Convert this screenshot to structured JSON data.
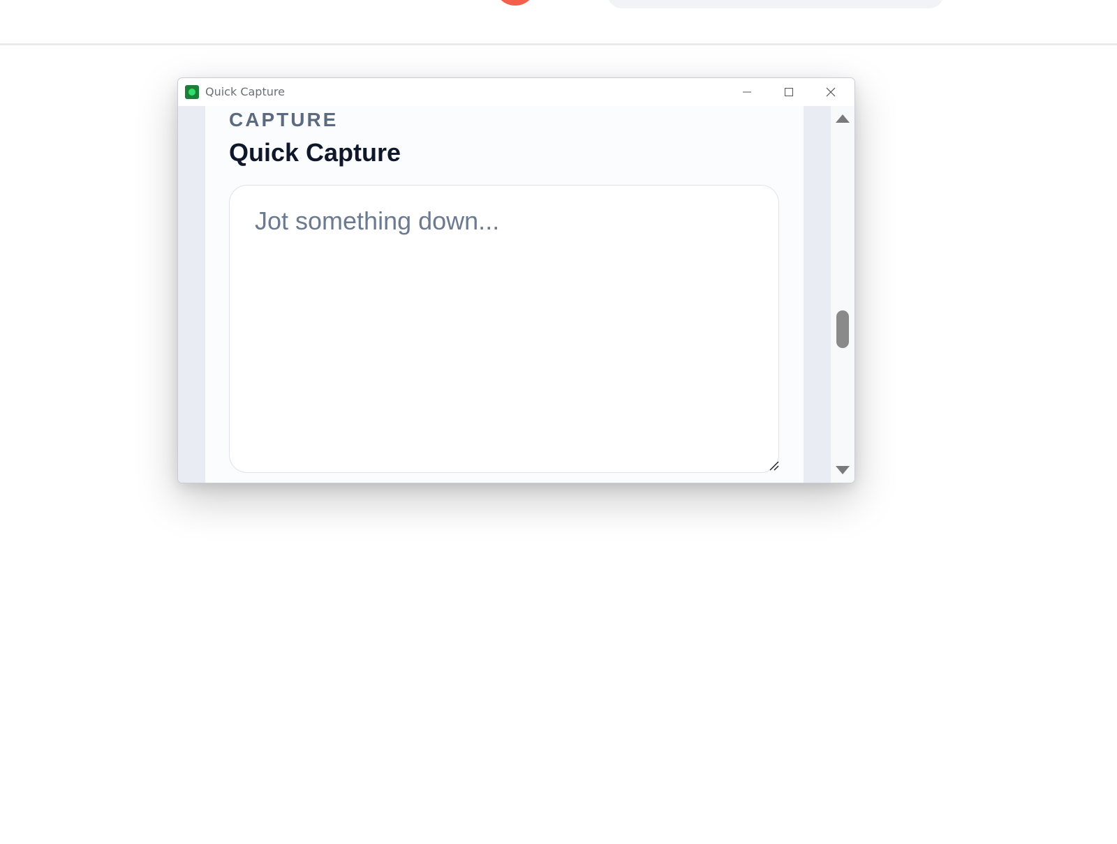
{
  "window": {
    "title": "Quick Capture",
    "app_icon": "app-icon",
    "controls": [
      "minimize-icon",
      "maximize-icon",
      "close-icon"
    ]
  },
  "panel": {
    "eyebrow": "CAPTURE",
    "heading": "Quick Capture",
    "textarea": {
      "placeholder": "Jot something down...",
      "value": ""
    }
  },
  "scrollbar": {
    "icons": [
      "arrow-up-icon",
      "arrow-down-icon"
    ],
    "thumb_position": 0.55
  },
  "colors": {
    "accent_avatar": "#f5604d",
    "heading": "#0f172a",
    "eyebrow": "#5c6a80",
    "placeholder": "#6b7a90",
    "app_icon": "#1b7f3a"
  }
}
